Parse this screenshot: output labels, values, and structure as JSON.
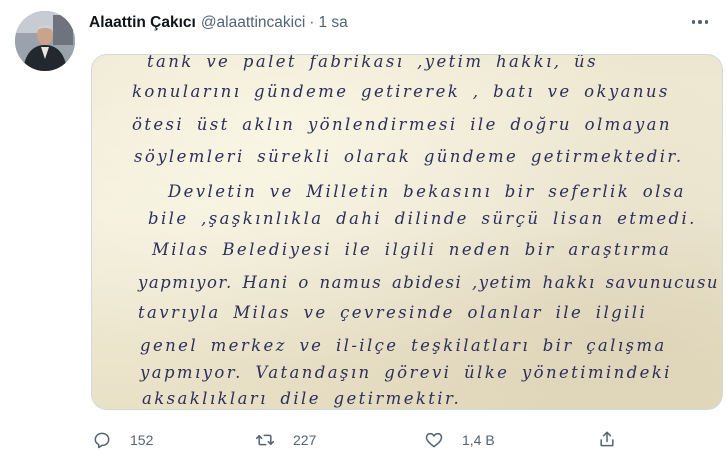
{
  "tweet": {
    "author_name": "Alaattin Çakıcı",
    "author_handle": "@alaattincakici",
    "separator": "·",
    "time": "1 sa"
  },
  "media": {
    "handwritten_lines": [
      "tank ve palet fabrikası ,yetim hakkı, üs",
      "konularını gündeme getirerek , batı ve okyanus",
      "ötesi üst aklın yönlendirmesi ile doğru olmayan",
      "söylemleri sürekli olarak gündeme getirmektedir.",
      "Devletin ve Milletin bekasını bir seferlik olsa",
      "bile ,şaşkınlıkla dahi dilinde sürçü lisan etmedi.",
      "Milas Belediyesi ile ilgili neden bir araştırma",
      "yapmıyor. Hani o namus abidesi ,yetim hakkı savunucusu",
      "tavrıyla Milas ve çevresinde olanlar ile ilgili",
      "genel merkez ve il-ilçe teşkilatları bir çalışma",
      "yapmıyor. Vatandaşın görevi ülke yönetimindeki",
      "aksaklıkları dile getirmektir."
    ]
  },
  "actions": {
    "reply": {
      "icon": "reply-icon",
      "count": "152"
    },
    "retweet": {
      "icon": "retweet-icon",
      "count": "227"
    },
    "like": {
      "icon": "heart-icon",
      "count": "1,4 B"
    },
    "share": {
      "icon": "share-icon"
    }
  },
  "colors": {
    "text_primary": "#0f1419",
    "text_secondary": "#536471",
    "ink": "#2d2f5c",
    "paper": "#f2ecd7",
    "border": "#cfd9de"
  }
}
